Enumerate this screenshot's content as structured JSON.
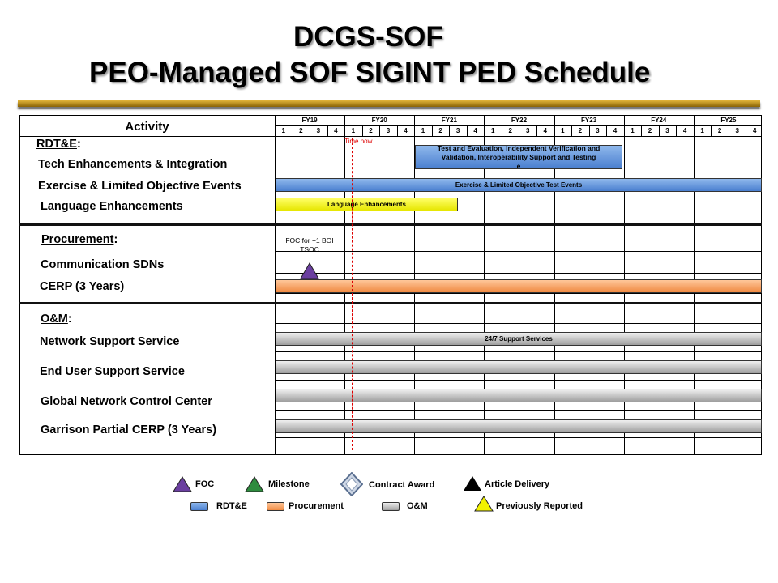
{
  "title": {
    "line1": "DCGS-SOF",
    "line2": "PEO-Managed SOF SIGINT PED Schedule"
  },
  "header": {
    "activity": "Activity",
    "fiscal_years": [
      "FY19",
      "FY20",
      "FY21",
      "FY22",
      "FY23",
      "FY24",
      "FY25"
    ],
    "quarters": [
      "1",
      "2",
      "3",
      "4"
    ]
  },
  "sections": {
    "rdte": {
      "name": "RDT&E",
      "suffix": ":"
    },
    "procurement": {
      "name": "Procurement",
      "suffix": ":"
    },
    "om": {
      "name": "O&M",
      "suffix": ":"
    }
  },
  "rows": {
    "tech": "Tech  Enhancements & Integration",
    "exercise": "Exercise & Limited Objective  Events",
    "language": "Language Enhancements",
    "comm": "Communication SDNs",
    "cerp": "CERP (3 Years)",
    "network": "Network Support Service",
    "enduser": "End User Support Service",
    "gncc": "Global Network Control Center",
    "garrison": "Garrison Partial CERP (3 Years)"
  },
  "bars": {
    "te_line1": "Test  and Evaluation, Independent Verification and",
    "te_line2": "Validation, Interoperability Support and Testing",
    "te_line3": "e",
    "exercise": "Exercise & Limited Objective Test Events",
    "language": "Language Enhancements",
    "support": "24/7 Support Services"
  },
  "annotations": {
    "time_now": "Time now",
    "foc_line1": "FOC for +1 BOI",
    "foc_line2": "TSOC"
  },
  "legend": {
    "foc": "FOC",
    "milestone": "Milestone",
    "contract": "Contract Award",
    "article": "Article Delivery",
    "rdte": "RDT&E",
    "procurement": "Procurement",
    "om": "O&M",
    "previous": "Previously  Reported"
  },
  "colors": {
    "foc": "#6b3fa0",
    "milestone": "#2e8b3e",
    "article": "#000000",
    "previous": "#f2f200",
    "rdte": "#4a7fcf",
    "procurement": "#f08a42",
    "om": "#a0a0a0"
  }
}
